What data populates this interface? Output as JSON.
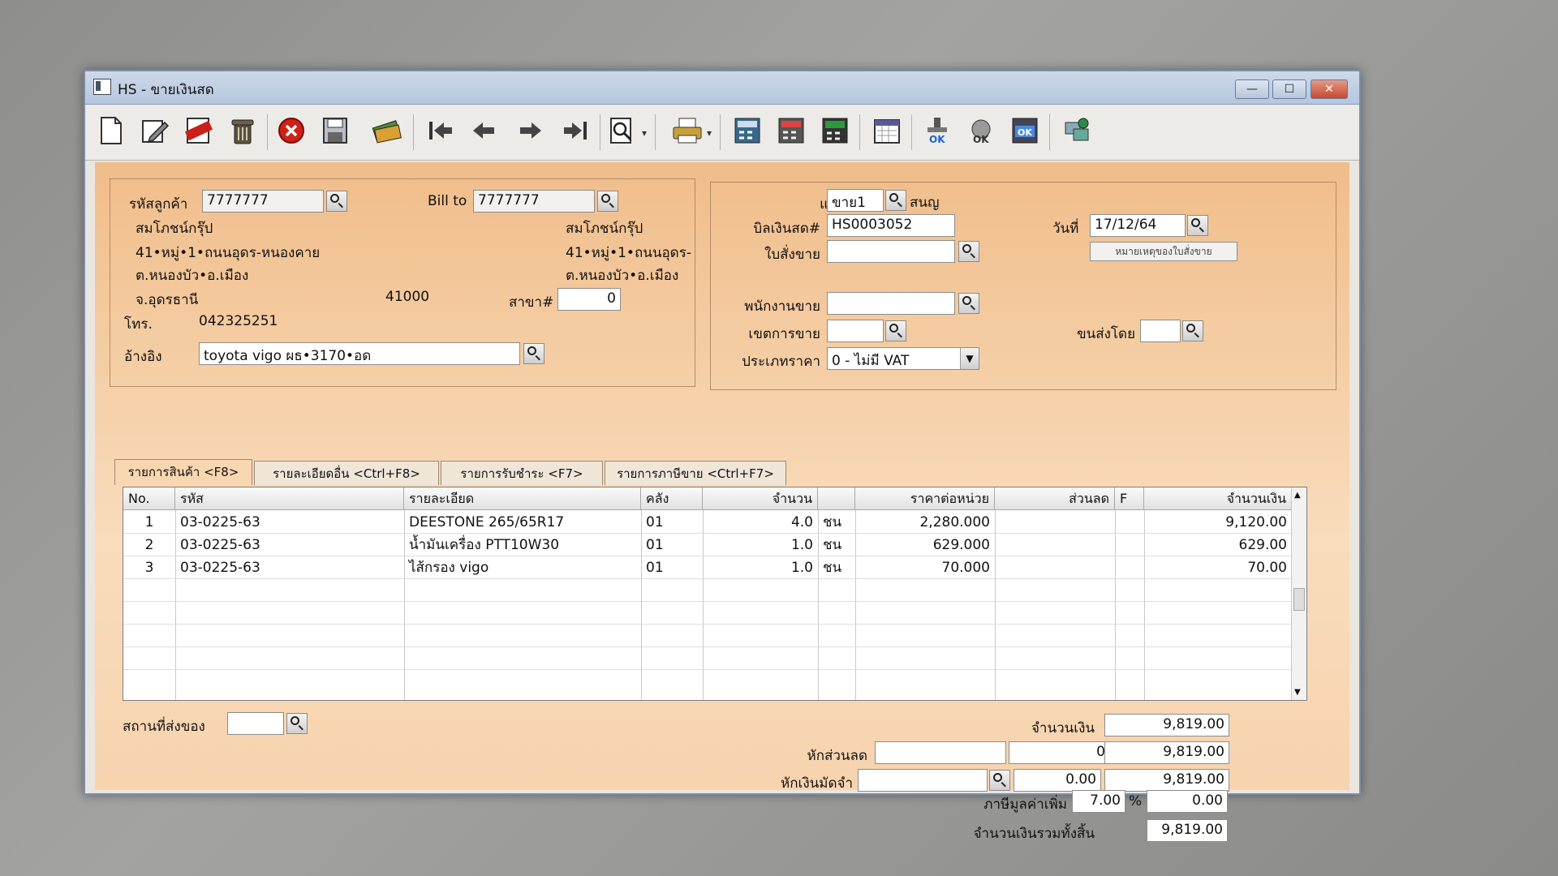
{
  "window": {
    "title": "HS - ขายเงินสด",
    "minimize": "—",
    "maximize": "☐",
    "close": "✕"
  },
  "toolbar": {
    "icons": [
      "new-document-icon",
      "edit-icon",
      "void-icon",
      "trash-icon",
      "cancel-icon",
      "save-icon",
      "money-icon",
      "first-record-icon",
      "previous-record-icon",
      "next-record-icon",
      "last-record-icon",
      "search-icon",
      "print-icon",
      "calculator-icon",
      "calculator-2-icon",
      "calculator-3-icon",
      "calendar-icon",
      "ok-stamp-icon",
      "ok-tool-icon",
      "ok-check-icon",
      "network-icon"
    ]
  },
  "customer": {
    "code_label": "รหัสลูกค้า",
    "code": "7777777",
    "billto_label": "Bill to",
    "billto": "7777777",
    "name": "สมโภชน์กรุ๊ป",
    "addr1": "41•หมู่•1•ถนนอุดร-หนองคาย",
    "addr2": "ต.หนองบัว•อ.เมือง",
    "addr3": "จ.อุดรธานี",
    "zip": "41000",
    "bill_name": "สมโภชน์กรุ๊ป",
    "bill_addr1": "41•หมู่•1•ถนนอุดร-",
    "bill_addr2": "ต.หนองบัว•อ.เมือง",
    "branch_label": "สาขา#",
    "branch": "0",
    "phone_label": "โทร.",
    "phone": "042325251",
    "ref_label": "อ้างอิง",
    "ref": "toyota vigo ผธ•3170•อด"
  },
  "doc": {
    "dept_label": "แผนก",
    "dept": "ขาย1",
    "dept_name": "สนญ",
    "bill_label": "บิลเงินสด#",
    "bill_no": "HS0003052",
    "date_label": "วันที่",
    "date": "17/12/64",
    "so_label": "ใบสั่งขาย",
    "so": "",
    "so_note_button": "หมายเหตุของใบสั่งขาย",
    "sales_label": "พนักงานขาย",
    "sales": "",
    "area_label": "เขตการขาย",
    "area": "",
    "ship_label": "ขนส่งโดย",
    "ship": "",
    "price_type_label": "ประเภทราคา",
    "price_type": "0 - ไม่มี VAT"
  },
  "tabs": [
    "รายการสินค้า <F8>",
    "รายละเอียดอื่น <Ctrl+F8>",
    "รายการรับชำระ <F7>",
    "รายการภาษีขาย <Ctrl+F7>"
  ],
  "grid": {
    "headers": [
      "No.",
      "รหัส",
      "รายละเอียด",
      "คลัง",
      "จำนวน",
      "",
      "ราคาต่อหน่วย",
      "ส่วนลด",
      "F",
      "จำนวนเงิน"
    ],
    "rows": [
      {
        "no": "1",
        "code": "03-0225-63",
        "desc": "DEESTONE 265/65R17",
        "wh": "01",
        "qty": "4.0",
        "unit": "ชน",
        "price": "2,280.000",
        "disc": "",
        "f": "",
        "amount": "9,120.00"
      },
      {
        "no": "2",
        "code": "03-0225-63",
        "desc": "น้ำมันเครื่อง PTT10W30",
        "wh": "01",
        "qty": "1.0",
        "unit": "ชน",
        "price": "629.000",
        "disc": "",
        "f": "",
        "amount": "629.00"
      },
      {
        "no": "3",
        "code": "03-0225-63",
        "desc": "ไส้กรอง vigo",
        "wh": "01",
        "qty": "1.0",
        "unit": "ชน",
        "price": "70.000",
        "disc": "",
        "f": "",
        "amount": "70.00"
      }
    ]
  },
  "footer": {
    "location_label": "สถานที่ส่งของ",
    "location": "",
    "total_label": "จำนวนเงิน",
    "total": "9,819.00",
    "discount_label": "หักส่วนลด",
    "discount_text": "",
    "discount_amt": "0.00",
    "after_discount": "9,819.00",
    "deposit_label": "หักเงินมัดจำ",
    "deposit_text": "",
    "deposit_amt": "0.00",
    "after_deposit": "9,819.00",
    "vat_label": "ภาษีมูลค่าเพิ่ม",
    "vat_rate": "7.00",
    "vat_pct": "%",
    "vat_amt": "0.00",
    "grand_label": "จำนวนเงินรวมทั้งสิ้น",
    "grand_total": "9,819.00"
  }
}
